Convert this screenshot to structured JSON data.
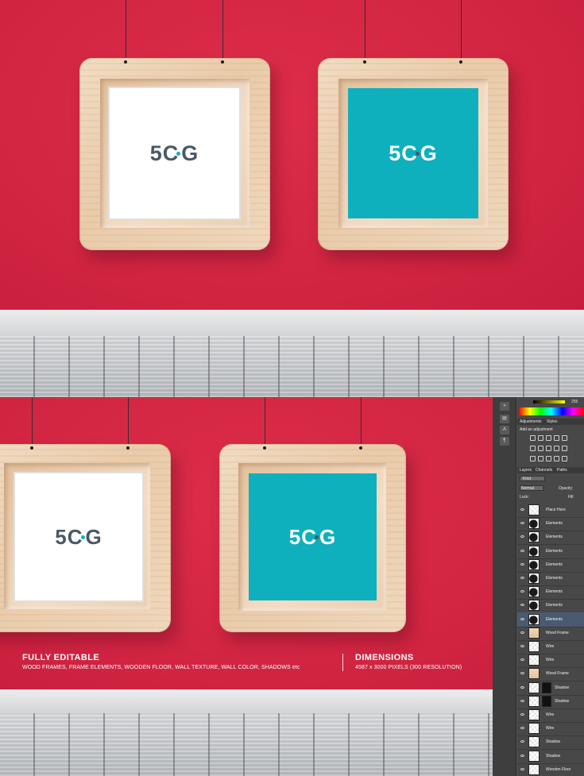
{
  "logo": {
    "text_left": "5",
    "text_mid": "C",
    "text_right": "G",
    "accent": "#0fb0bd",
    "dark": "#4a5866",
    "light": "#ffffff"
  },
  "colors": {
    "wall": "#d32643",
    "teal_poster": "#0fb0bd",
    "wood": "#efd6bb"
  },
  "captions": {
    "left_title": "FULLY EDITABLE",
    "left_sub": "WOOD FRAMES, FRAME ELEMENTS, WOODEN FLOOR, WALL TEXTURE, WALL COLOR, SHADOWS etc",
    "right_title": "DIMENSIONS",
    "right_sub": "4587 x 3000 PIXELS (300 RESOLUTION)"
  },
  "photoshop": {
    "color_value": "255",
    "tabs_adjust": [
      "Adjustments",
      "Styles"
    ],
    "add_adjustment": "Add an adjustment",
    "tabs_layers": [
      "Layers",
      "Channels",
      "Paths"
    ],
    "kind_label": "Kind",
    "blend_mode": "Normal",
    "opacity_label": "Opacity:",
    "lock_label": "Lock:",
    "fill_label": "Fill:",
    "layers": [
      {
        "name": "Place Here"
      },
      {
        "name": "Elements"
      },
      {
        "name": "Elements"
      },
      {
        "name": "Elements"
      },
      {
        "name": "Elements"
      },
      {
        "name": "Elements"
      },
      {
        "name": "Elements"
      },
      {
        "name": "Elements"
      },
      {
        "name": "Elements"
      },
      {
        "name": "Wood Frame"
      },
      {
        "name": "Wire"
      },
      {
        "name": "Wire"
      },
      {
        "name": "Wood Frame"
      },
      {
        "name": "Shadow"
      },
      {
        "name": "Shadow"
      },
      {
        "name": "Wire"
      },
      {
        "name": "Wire"
      },
      {
        "name": "Shadow"
      },
      {
        "name": "Shadow"
      },
      {
        "name": "Wooden Floor"
      }
    ]
  }
}
